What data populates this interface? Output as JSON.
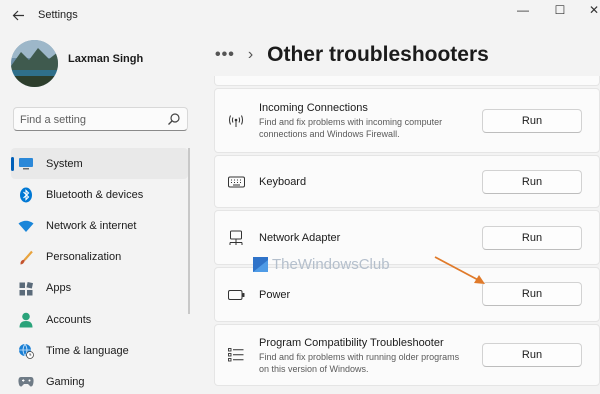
{
  "window": {
    "title": "Settings",
    "controls": {
      "minimize": "—",
      "maximize": "☐",
      "close": "✕"
    }
  },
  "profile": {
    "name": "Laxman Singh"
  },
  "search": {
    "placeholder": "Find a setting"
  },
  "sidebar": {
    "items": [
      {
        "label": "System",
        "icon": "monitor-icon",
        "active": true
      },
      {
        "label": "Bluetooth & devices",
        "icon": "bluetooth-icon"
      },
      {
        "label": "Network & internet",
        "icon": "wifi-icon"
      },
      {
        "label": "Personalization",
        "icon": "brush-icon"
      },
      {
        "label": "Apps",
        "icon": "apps-icon"
      },
      {
        "label": "Accounts",
        "icon": "person-icon"
      },
      {
        "label": "Time & language",
        "icon": "globe-clock-icon"
      },
      {
        "label": "Gaming",
        "icon": "gamepad-icon"
      }
    ]
  },
  "breadcrumb": {
    "more": "•••",
    "separator": "›",
    "title": "Other troubleshooters"
  },
  "troubleshooters": [
    {
      "title": "Incoming Connections",
      "description": "Find and fix problems with incoming computer connections and Windows Firewall.",
      "button": "Run",
      "icon": "antenna-icon"
    },
    {
      "title": "Keyboard",
      "description": "",
      "button": "Run",
      "icon": "keyboard-icon"
    },
    {
      "title": "Network Adapter",
      "description": "",
      "button": "Run",
      "icon": "network-adapter-icon"
    },
    {
      "title": "Power",
      "description": "",
      "button": "Run",
      "icon": "battery-icon"
    },
    {
      "title": "Program Compatibility Troubleshooter",
      "description": "Find and fix problems with running older programs on this version of Windows.",
      "button": "Run",
      "icon": "list-icon"
    }
  ],
  "watermark": {
    "text": "TheWindowsClub"
  },
  "colors": {
    "accent": "#005fb8",
    "annotation_arrow": "#e07a2a"
  }
}
